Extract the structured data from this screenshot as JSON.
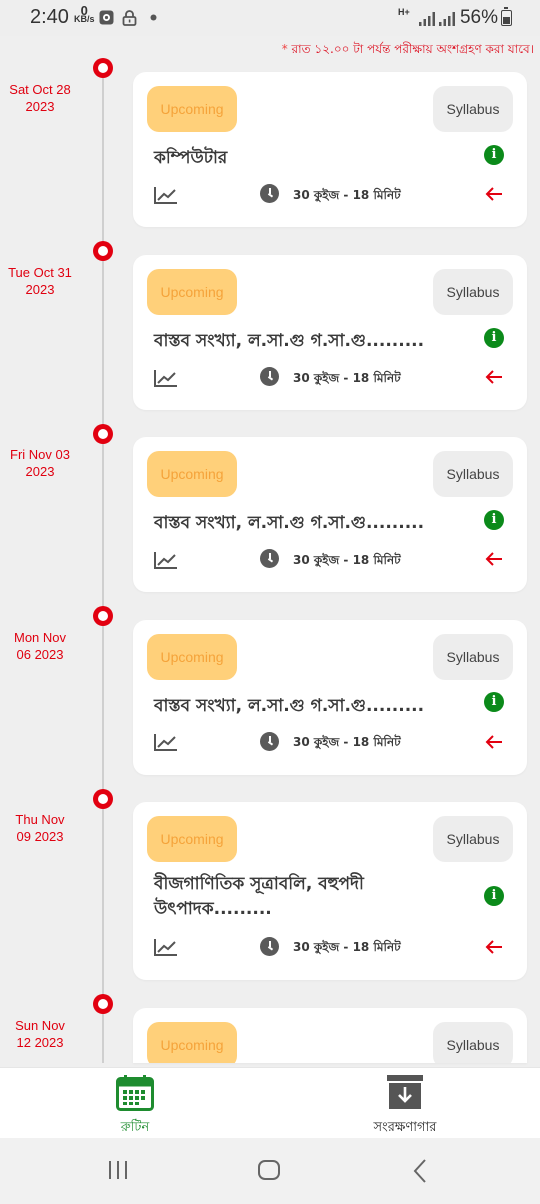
{
  "status_bar": {
    "time": "2:40",
    "net_speed_value": "0",
    "net_speed_unit": "KB/s",
    "network_type": "H+",
    "battery": "56%"
  },
  "notice": {
    "star": "*",
    "text": "রাত ১২.০০ টা পর্যন্ত পরীক্ষায় অংশগ্রহণ করা যাবে।"
  },
  "schedule": [
    {
      "date": "Sat Oct 28 2023",
      "date_line1": "Sat Oct 28",
      "date_line2": "2023",
      "status": "Upcoming",
      "syllabus": "Syllabus",
      "title": "কম্পিউটার",
      "meta": "30 কুইজ - 18 মিনিট"
    },
    {
      "date": "Tue Oct 31 2023",
      "date_line1": "Tue Oct 31",
      "date_line2": "2023",
      "status": "Upcoming",
      "syllabus": "Syllabus",
      "title": "বাস্তব সংখ্যা, ল.সা.গু গ.সা.গু.........",
      "meta": "30 কুইজ - 18 মিনিট"
    },
    {
      "date": "Fri Nov 03 2023",
      "date_line1": "Fri Nov 03",
      "date_line2": "2023",
      "status": "Upcoming",
      "syllabus": "Syllabus",
      "title": "বাস্তব সংখ্যা, ল.সা.গু গ.সা.গু.........",
      "meta": "30 কুইজ - 18 মিনিট"
    },
    {
      "date": "Mon Nov 06 2023",
      "date_line1": "Mon Nov",
      "date_line2": "06 2023",
      "status": "Upcoming",
      "syllabus": "Syllabus",
      "title": "বাস্তব সংখ্যা, ল.সা.গু গ.সা.গু.........",
      "meta": "30 কুইজ - 18 মিনিট"
    },
    {
      "date": "Thu Nov 09 2023",
      "date_line1": "Thu Nov",
      "date_line2": "09 2023",
      "status": "Upcoming",
      "syllabus": "Syllabus",
      "title": "বীজগাণিতিক সূত্রাবলি, বহুপদী উৎপাদক.........",
      "meta": "30 কুইজ - 18 মিনিট"
    },
    {
      "date": "Sun Nov 12 2023",
      "date_line1": "Sun Nov",
      "date_line2": "12 2023",
      "status": "Upcoming",
      "syllabus": "Syllabus",
      "title": "",
      "meta": ""
    }
  ],
  "bottom_nav": {
    "routine_label": "রুটিন",
    "archive_label": "সংরক্ষণাগার",
    "active": "routine"
  },
  "colors": {
    "accent_red": "#e20010",
    "upcoming_bg": "#ffd07a",
    "upcoming_text": "#f5a33a",
    "info_green": "#0b8a1a",
    "nav_active_green": "#1e8c2f"
  },
  "icons": [
    "calendar-icon",
    "archive-download-icon",
    "trending-up-icon",
    "clock-icon",
    "info-icon",
    "arrow-left-icon",
    "recent-apps-icon",
    "home-icon",
    "back-icon",
    "lock-icon",
    "wifi-icon",
    "signal-icon",
    "battery-icon"
  ]
}
